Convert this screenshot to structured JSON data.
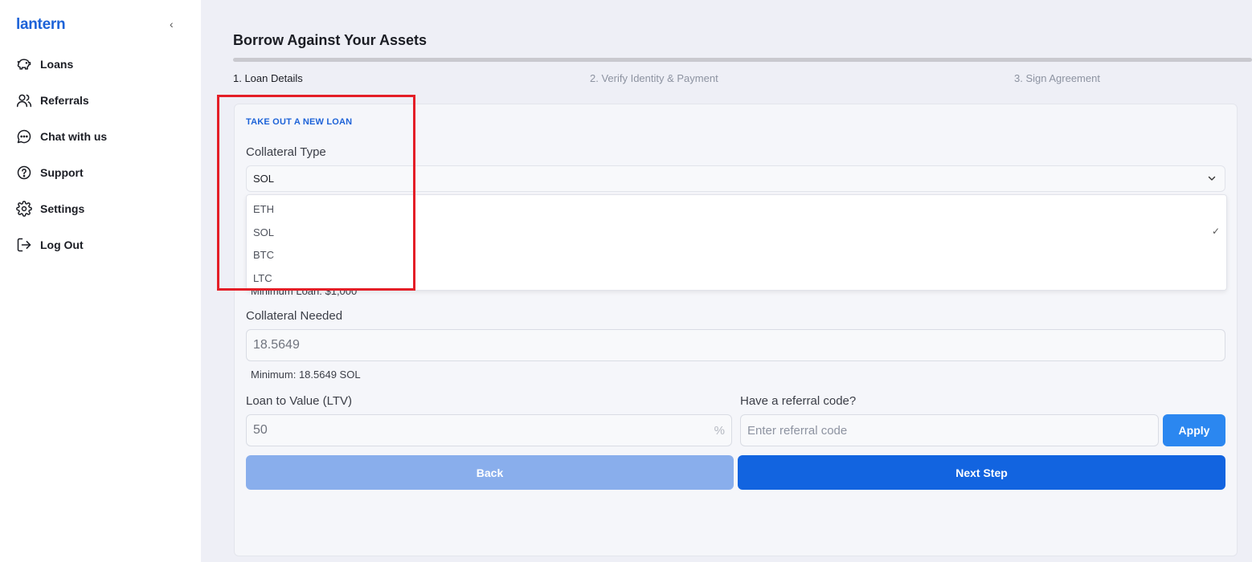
{
  "app": {
    "logo": "lantern",
    "collapse_glyph": "‹"
  },
  "sidebar": {
    "items": [
      {
        "label": "Loans",
        "icon": "piggy-bank-icon"
      },
      {
        "label": "Referrals",
        "icon": "users-icon"
      },
      {
        "label": "Chat with us",
        "icon": "chat-bubble-icon"
      },
      {
        "label": "Support",
        "icon": "help-circle-icon"
      },
      {
        "label": "Settings",
        "icon": "gear-icon"
      },
      {
        "label": "Log Out",
        "icon": "logout-icon"
      }
    ]
  },
  "header": {
    "title": "Borrow Against Your Assets"
  },
  "steps": [
    {
      "label": "1. Loan Details",
      "active": true
    },
    {
      "label": "2. Verify Identity & Payment",
      "active": false
    },
    {
      "label": "3. Sign Agreement",
      "active": false
    }
  ],
  "form": {
    "section_title": "TAKE OUT A NEW LOAN",
    "collateral_type": {
      "label": "Collateral Type",
      "selected": "SOL",
      "options": [
        "ETH",
        "SOL",
        "BTC",
        "LTC"
      ],
      "check_glyph": "✓"
    },
    "min_loan_hint": "Minimum Loan: $1,000",
    "collateral_needed": {
      "label": "Collateral Needed",
      "value": "18.5649",
      "hint": "Minimum: 18.5649 SOL"
    },
    "ltv": {
      "label": "Loan to Value (LTV)",
      "value": "50",
      "suffix": "%"
    },
    "referral": {
      "label": "Have a referral code?",
      "placeholder": "Enter referral code",
      "apply_label": "Apply"
    },
    "back_label": "Back",
    "next_label": "Next Step"
  },
  "colors": {
    "brand": "#1d63d8",
    "primary_button": "#1264e0",
    "disabled_button": "#89aeec",
    "apply_button": "#2b87f0",
    "highlight_box": "#e41e27"
  }
}
